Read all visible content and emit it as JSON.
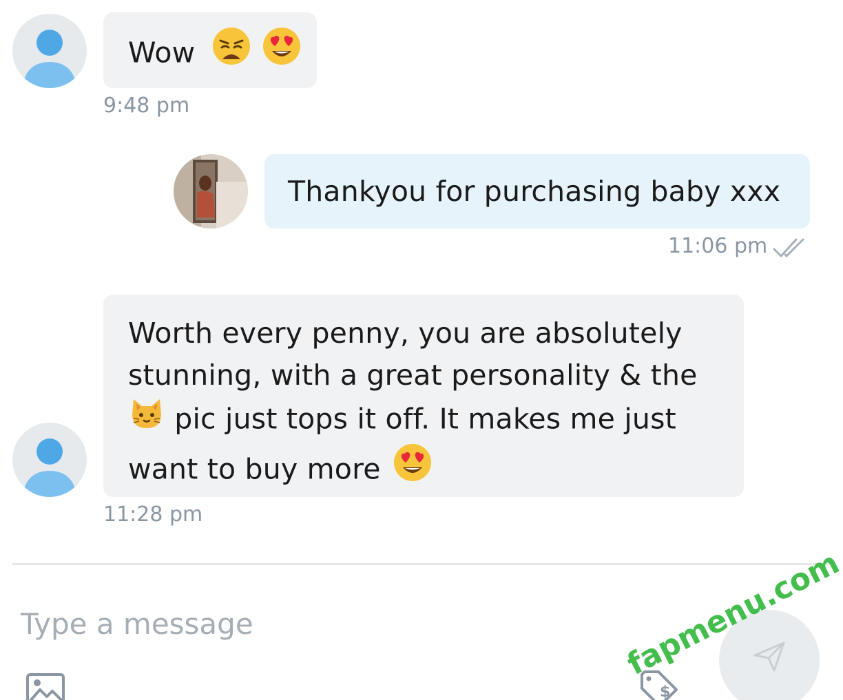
{
  "messages": [
    {
      "direction": "incoming",
      "text": "Wow",
      "emojis": [
        "weary-face-emoji",
        "heart-eyes-emoji"
      ],
      "time": "9:48 pm"
    },
    {
      "direction": "outgoing",
      "text": "Thankyou for purchasing baby xxx",
      "time": "11:06 pm",
      "status": "read-double-check"
    },
    {
      "direction": "incoming",
      "lines": [
        "Worth every penny, you are absolutely",
        "stunning, with a great personality & the",
        " pic just tops it off. It makes me just",
        "want to buy more "
      ],
      "emojis": [
        "cat-face-emoji",
        "heart-eyes-emoji"
      ],
      "time": "11:28 pm"
    }
  ],
  "composer": {
    "placeholder": "Type a message"
  },
  "toolbar": {
    "icons": [
      "image-icon",
      "price-tag-dollar-icon",
      "send-icon"
    ]
  },
  "watermark": "fapmenu.com",
  "colors": {
    "incoming_bubble": "#f1f2f4",
    "outgoing_bubble": "#e6f3fb",
    "timestamp": "#8a96a3",
    "watermark": "#2fb83a"
  }
}
